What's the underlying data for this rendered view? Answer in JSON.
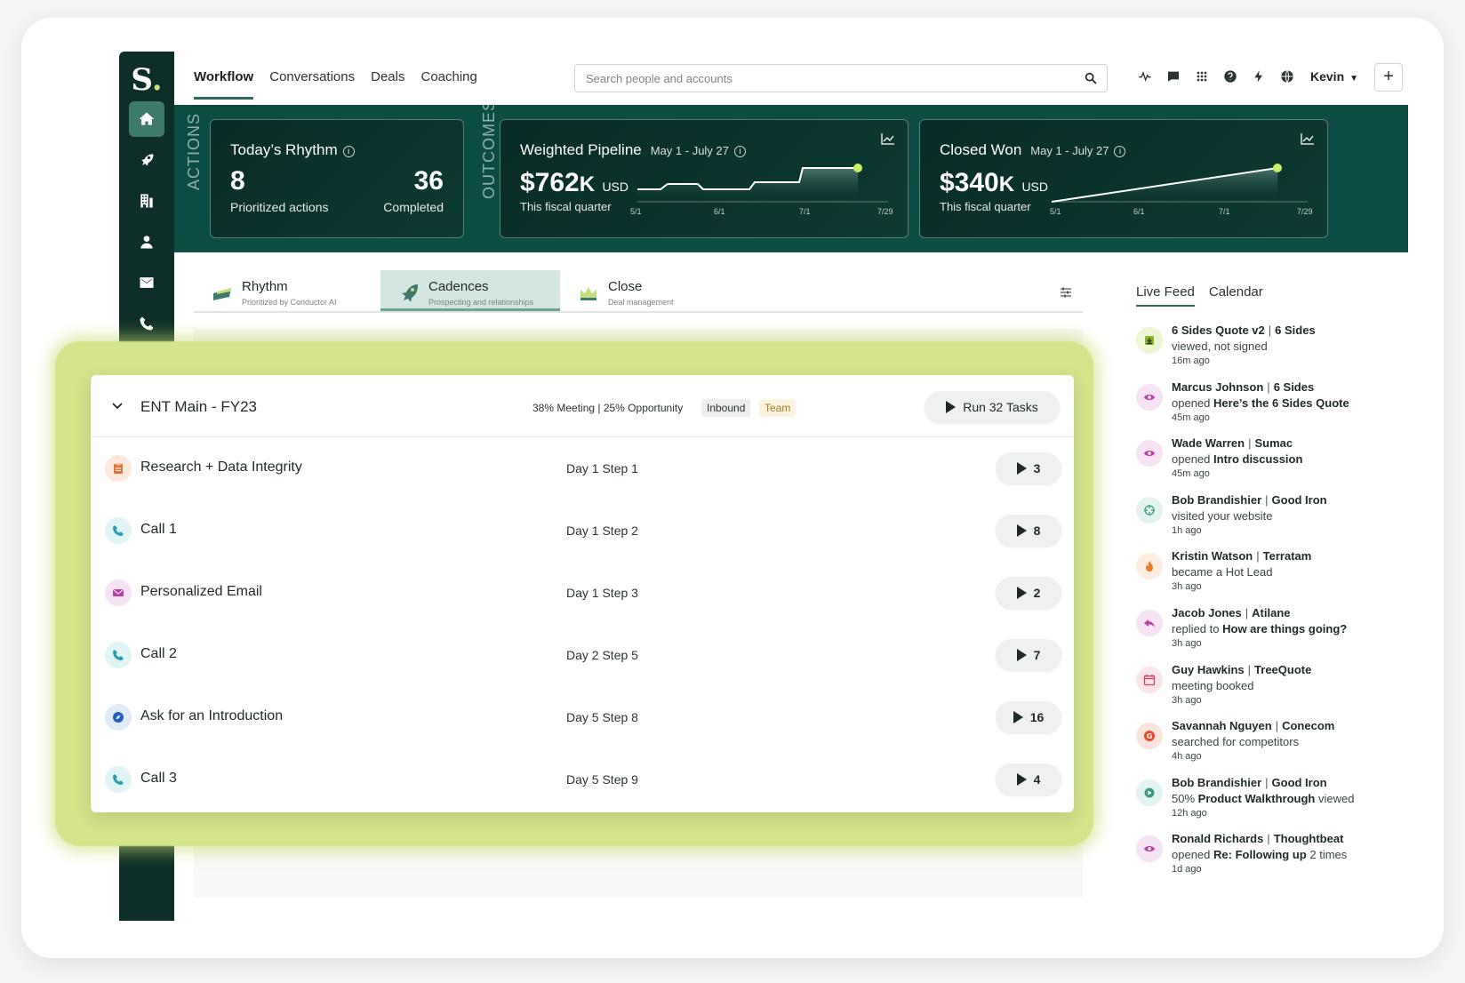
{
  "brand": {
    "logo_letter": "S",
    "logo_dot": "."
  },
  "nav": {
    "tabs": [
      "Workflow",
      "Conversations",
      "Deals",
      "Coaching"
    ],
    "active_tab": "Workflow"
  },
  "search": {
    "placeholder": "Search people and accounts"
  },
  "user": {
    "name": "Kevin"
  },
  "topbar_icons": [
    "activity-icon",
    "chat-icon",
    "apps-grid-icon",
    "help-icon",
    "lightning-icon",
    "globe-icon"
  ],
  "rail_icons": [
    "home-icon",
    "rocket-icon",
    "building-icon",
    "person-icon",
    "mail-icon",
    "phone-icon"
  ],
  "banner": {
    "actions_label": "ACTIONS",
    "outcomes_label": "OUTCOMES",
    "rhythm": {
      "title": "Today’s Rhythm",
      "prioritized_count": "8",
      "prioritized_label": "Prioritized actions",
      "completed_count": "36",
      "completed_label": "Completed"
    },
    "pipeline": {
      "title": "Weighted Pipeline",
      "date_range": "May 1 - July 27",
      "amount": "$762",
      "suffix": "K",
      "currency": "USD",
      "sublabel": "This fiscal quarter",
      "ticks": [
        "5/1",
        "6/1",
        "7/1",
        "7/29"
      ]
    },
    "closed": {
      "title": "Closed Won",
      "date_range": "May 1 - July 27",
      "amount": "$340",
      "suffix": "K",
      "currency": "USD",
      "sublabel": "This fiscal quarter",
      "ticks": [
        "5/1",
        "6/1",
        "7/1",
        "7/29"
      ]
    }
  },
  "subtabs": [
    {
      "title": "Rhythm",
      "subtitle": "Prioritized by Conductor AI"
    },
    {
      "title": "Cadences",
      "subtitle": "Prospecting and relationships"
    },
    {
      "title": "Close",
      "subtitle": "Deal management"
    }
  ],
  "cadence": {
    "title": "ENT Main - FY23",
    "stats": "38% Meeting | 25% Opportunity",
    "badges": [
      "Inbound",
      "Team"
    ],
    "run_label": "Run 32 Tasks",
    "steps": [
      {
        "name": "Research + Data Integrity",
        "day": "Day 1 Step 1",
        "count": "3",
        "icon": "clipboard-icon"
      },
      {
        "name": "Call 1",
        "day": "Day 1 Step 2",
        "count": "8",
        "icon": "phone-icon"
      },
      {
        "name": "Personalized Email",
        "day": "Day 1 Step 3",
        "count": "2",
        "icon": "mail-icon"
      },
      {
        "name": "Call 2",
        "day": "Day 2 Step 5",
        "count": "7",
        "icon": "phone-icon"
      },
      {
        "name": "Ask for an Introduction",
        "day": "Day 5 Step 8",
        "count": "16",
        "icon": "compass-icon"
      },
      {
        "name": "Call 3",
        "day": "Day 5 Step 9",
        "count": "4",
        "icon": "phone-icon"
      }
    ]
  },
  "feed": {
    "tabs": [
      "Live Feed",
      "Calendar"
    ],
    "items": [
      {
        "who": "6 Sides Quote v2",
        "org": "6 Sides",
        "pre": "viewed, not signed",
        "bold": "",
        "post": "",
        "time": "16m ago",
        "icon": "download-icon"
      },
      {
        "who": "Marcus Johnson",
        "org": "6 Sides",
        "pre": "opened",
        "bold": "Here’s the 6 Sides Quote",
        "post": "",
        "time": "45m ago",
        "icon": "eye-icon"
      },
      {
        "who": "Wade Warren",
        "org": "Sumac",
        "pre": "opened",
        "bold": "Intro discussion",
        "post": "",
        "time": "45m ago",
        "icon": "eye-icon"
      },
      {
        "who": "Bob Brandishier",
        "org": "Good Iron",
        "pre": "visited your website",
        "bold": "",
        "post": "",
        "time": "1h ago",
        "icon": "crosshair-icon"
      },
      {
        "who": "Kristin Watson",
        "org": "Terratam",
        "pre": "became a Hot Lead",
        "bold": "",
        "post": "",
        "time": "3h ago",
        "icon": "flame-icon"
      },
      {
        "who": "Jacob Jones",
        "org": "Atilane",
        "pre": "replied to",
        "bold": "How are things going?",
        "post": "",
        "time": "3h ago",
        "icon": "reply-icon"
      },
      {
        "who": "Guy Hawkins",
        "org": "TreeQuote",
        "pre": "meeting booked",
        "bold": "",
        "post": "",
        "time": "3h ago",
        "icon": "calendar-icon"
      },
      {
        "who": "Savannah Nguyen",
        "org": "Conecom",
        "pre": "searched for competitors",
        "bold": "",
        "post": "",
        "time": "4h ago",
        "icon": "g2-icon"
      },
      {
        "who": "Bob Brandishier",
        "org": "Good Iron",
        "pre": "50%",
        "bold": "Product Walkthrough",
        "post": "viewed",
        "time": "12h ago",
        "icon": "video-icon"
      },
      {
        "who": "Ronald Richards",
        "org": "Thoughtbeat",
        "pre": "opened",
        "bold": "Re: Following up",
        "post": "2 times",
        "time": "1d ago",
        "icon": "eye-icon"
      }
    ]
  }
}
